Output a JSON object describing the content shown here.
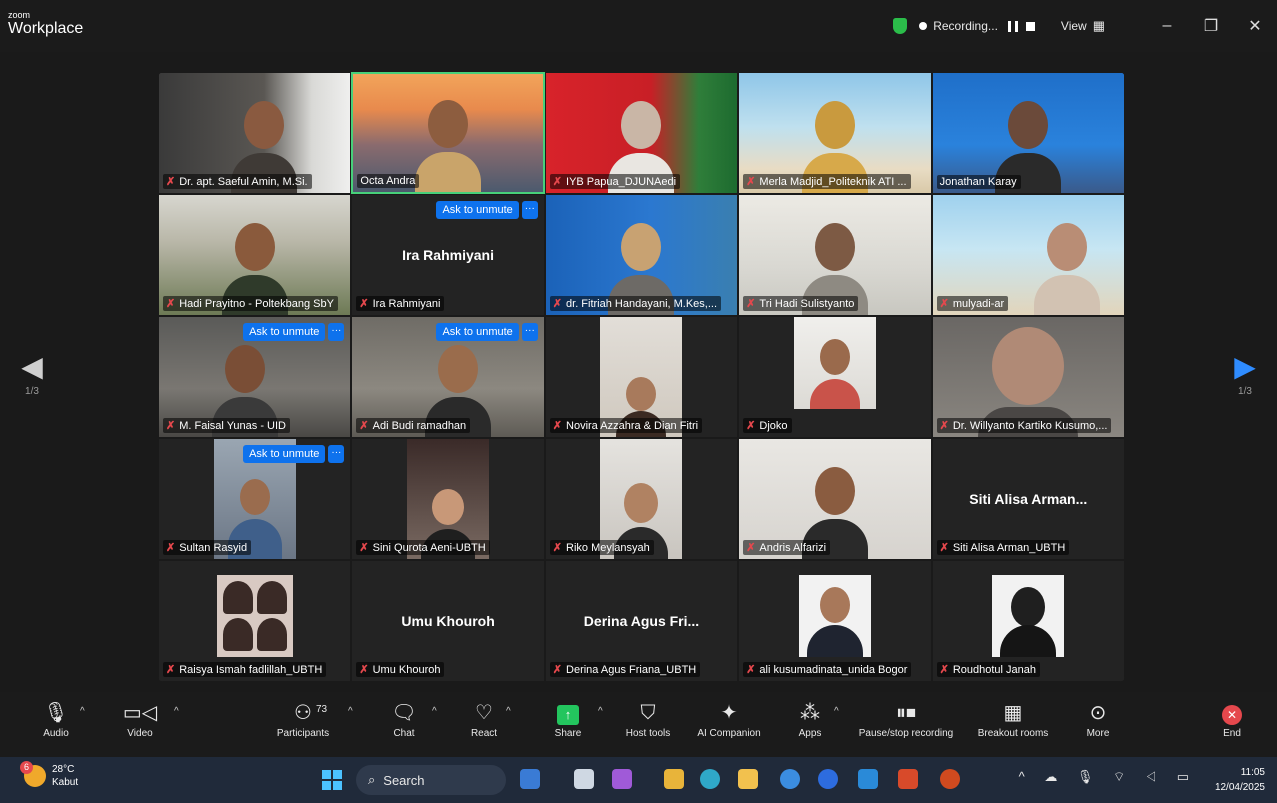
{
  "titlebar": {
    "brand_small": "zoom",
    "brand_big": "Workplace",
    "recording_label": "Recording...",
    "view_label": "View",
    "minimize": "–",
    "restore": "❐",
    "close": "✕"
  },
  "stage": {
    "left_page": "1/3",
    "right_page": "1/3",
    "unmute_label": "Ask to unmute",
    "more_label": "···"
  },
  "participants": [
    {
      "name": "Dr. apt. Saeful Amin, M.Si.",
      "muted": true
    },
    {
      "name": "Octa Andra",
      "muted": false
    },
    {
      "name": "IYB Papua_DJUNAedi",
      "muted": true
    },
    {
      "name": "Merla Madjid_Politeknik ATI ...",
      "muted": true
    },
    {
      "name": "Jonathan Karay",
      "muted": false
    },
    {
      "name": "Hadi Prayitno - Poltekbang SbY",
      "muted": true
    },
    {
      "name": "Ira Rahmiyani",
      "center": "Ira Rahmiyani",
      "muted": true
    },
    {
      "name": "dr. Fitriah Handayani, M.Kes,...",
      "muted": true
    },
    {
      "name": "Tri Hadi Sulistyanto",
      "muted": true
    },
    {
      "name": "mulyadi-ar",
      "muted": true
    },
    {
      "name": "M. Faisal Yunas - UID",
      "muted": true
    },
    {
      "name": "Adi Budi ramadhan",
      "muted": true
    },
    {
      "name": "Novira Azzahra & Dian Fitri",
      "muted": true
    },
    {
      "name": "Djoko",
      "muted": true
    },
    {
      "name": "Dr. Willyanto Kartiko Kusumo,...",
      "muted": true
    },
    {
      "name": "Sultan Rasyid",
      "muted": true
    },
    {
      "name": "Sini Qurota Aeni-UBTH",
      "muted": true
    },
    {
      "name": "Riko Meylansyah",
      "muted": true
    },
    {
      "name": "Andris Alfarizi",
      "muted": true
    },
    {
      "name": "Siti Alisa Arman_UBTH",
      "center": "Siti Alisa Arman...",
      "muted": true
    },
    {
      "name": "Raisya Ismah fadlillah_UBTH",
      "muted": true
    },
    {
      "name": "Umu Khouroh",
      "center": "Umu Khouroh",
      "muted": true
    },
    {
      "name": "Derina Agus Friana_UBTH",
      "center": "Derina Agus Fri...",
      "muted": true
    },
    {
      "name": "ali kusumadinata_unida Bogor",
      "muted": true
    },
    {
      "name": "Roudhotul Janah",
      "muted": true
    }
  ],
  "toolbar": {
    "audio": "Audio",
    "video": "Video",
    "participants": "Participants",
    "participant_count": "73",
    "chat": "Chat",
    "react": "React",
    "share": "Share",
    "host_tools": "Host tools",
    "ai_companion": "AI Companion",
    "apps": "Apps",
    "pause_stop": "Pause/stop recording",
    "breakout": "Breakout rooms",
    "more": "More",
    "end": "End"
  },
  "taskbar": {
    "badge": "6",
    "temp": "28°C",
    "weather": "Kabut",
    "search": "Search",
    "time": "11:05",
    "date": "12/04/2025"
  },
  "colors": {
    "accent_blue": "#0e72ed",
    "mute_red": "#e5484d",
    "active_green": "#47d07a",
    "share_green": "#23c55e"
  }
}
